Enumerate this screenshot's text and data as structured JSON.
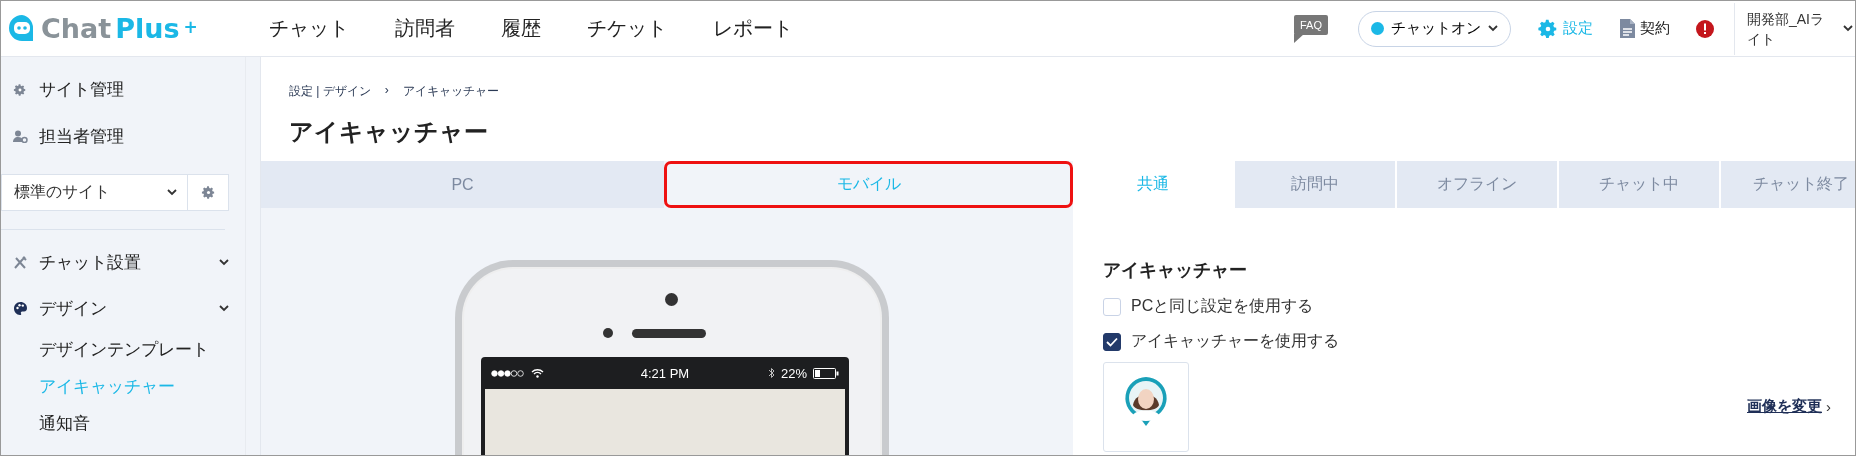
{
  "logo": {
    "word_1": "Chat",
    "word_2": "Plus",
    "mark": "+"
  },
  "nav": [
    {
      "label": "チャット"
    },
    {
      "label": "訪問者"
    },
    {
      "label": "履歴"
    },
    {
      "label": "チケット"
    },
    {
      "label": "レポート"
    }
  ],
  "header": {
    "faq": "FAQ",
    "status": {
      "label": "チャットオン",
      "on": true
    },
    "settings": "設定",
    "contract": "契約",
    "user": "開発部_AIライト"
  },
  "sidebar": {
    "items": [
      {
        "label": "サイト管理",
        "kind": "gear"
      },
      {
        "label": "担当者管理",
        "kind": "person"
      }
    ],
    "site_select": {
      "value": "標準のサイト"
    },
    "menu": [
      {
        "label": "チャット設置",
        "kind": "tools"
      },
      {
        "label": "デザイン",
        "kind": "palette",
        "children": [
          {
            "label": "デザインテンプレート",
            "selected": false
          },
          {
            "label": "アイキャッチャー",
            "selected": true
          },
          {
            "label": "通知音",
            "selected": false
          }
        ]
      }
    ]
  },
  "breadcrumb": {
    "parent": "設定 | デザイン",
    "separator": "›",
    "current": "アイキャッチャー"
  },
  "page_title": "アイキャッチャー",
  "device_tabs": [
    {
      "label": "PC",
      "selected": false,
      "highlighted": false
    },
    {
      "label": "モバイル",
      "selected": true,
      "highlighted": true
    }
  ],
  "phone_preview": {
    "time": "4:21 PM",
    "battery": "22%"
  },
  "state_tabs": [
    {
      "label": "共通",
      "selected": true
    },
    {
      "label": "訪問中",
      "selected": false
    },
    {
      "label": "オフライン",
      "selected": false
    },
    {
      "label": "チャット中",
      "selected": false
    },
    {
      "label": "チャット終了",
      "selected": false
    }
  ],
  "settings_panel": {
    "heading": "アイキャッチャー",
    "options": [
      {
        "label": "PCと同じ設定を使用する",
        "checked": false
      },
      {
        "label": "アイキャッチャーを使用する",
        "checked": true
      }
    ],
    "change_link": {
      "label": "画像を変更",
      "arrow": "›"
    }
  }
}
